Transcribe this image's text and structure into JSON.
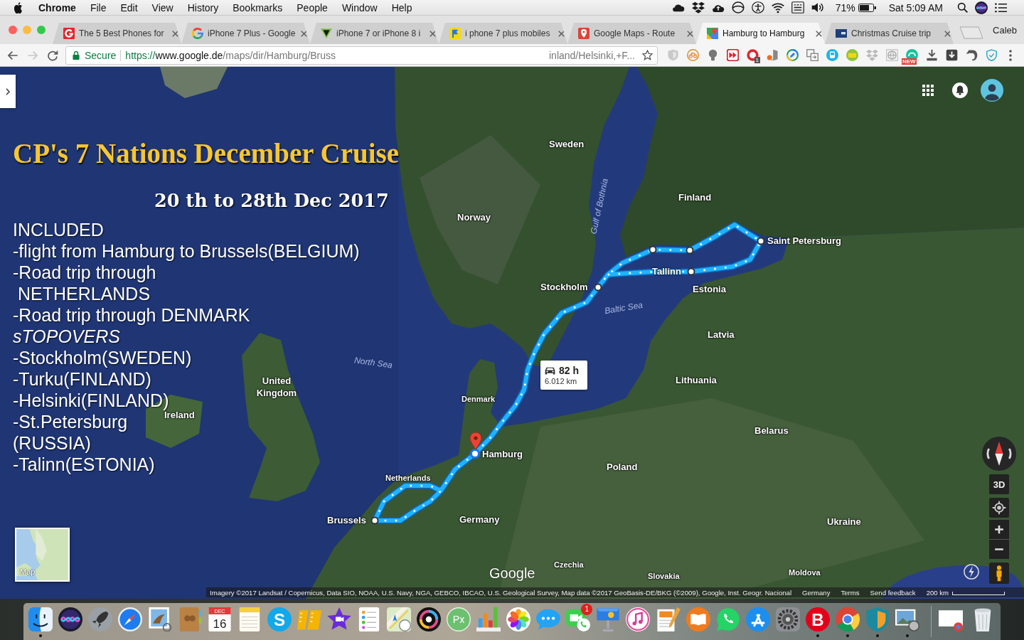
{
  "menu_bar": {
    "app_name": "Chrome",
    "items": [
      "File",
      "Edit",
      "View",
      "History",
      "Bookmarks",
      "People",
      "Window",
      "Help"
    ],
    "battery": "71%",
    "clock": "Sat 5:09 AM"
  },
  "tabs": [
    {
      "title": "The 5 Best Phones for",
      "selected": false
    },
    {
      "title": "iPhone 7 Plus - Google",
      "selected": false
    },
    {
      "title": "iPhone 7 or iPhone 8 i",
      "selected": false
    },
    {
      "title": "i phone 7 plus mobiles",
      "selected": false
    },
    {
      "title": "Google Maps - Route",
      "selected": false
    },
    {
      "title": "Hamburg to Hamburg",
      "selected": true
    },
    {
      "title": "Christmas Cruise trip",
      "selected": false
    }
  ],
  "profile": "Caleb",
  "toolbar": {
    "nav_buttons": [
      {
        "kind": "back",
        "disabled": false
      },
      {
        "kind": "forward",
        "disabled": true
      },
      {
        "kind": "reload",
        "disabled": false
      }
    ],
    "security": "Secure",
    "url": {
      "scheme": "https://",
      "host": "www.google.de",
      "path": "/maps/dir/Hamburg/Bruss",
      "tail": "inland/Helsinki,+F..."
    },
    "extensions": [
      {
        "kind": "shield"
      },
      {
        "kind": "bicycle"
      },
      {
        "kind": "bulb"
      },
      {
        "kind": "forward"
      },
      {
        "kind": "ring",
        "badge": "1"
      },
      {
        "kind": "office"
      },
      {
        "kind": "pen"
      },
      {
        "kind": "copy"
      },
      {
        "kind": "bus"
      },
      {
        "kind": "card"
      },
      {
        "kind": "boxes"
      },
      {
        "kind": "globe"
      },
      {
        "kind": "arc",
        "badge": "NEW"
      },
      {
        "kind": "tray"
      },
      {
        "kind": "download"
      },
      {
        "kind": "elephant"
      },
      {
        "kind": "check-shield"
      }
    ]
  },
  "map": {
    "title": "CP's 7 Nations December Cruise",
    "dates": "20 th to 28th Dec 2017",
    "included_lines": [
      {
        "text": "INCLUDED",
        "italic": false
      },
      {
        "text": "-flight from Hamburg to Brussels(BELGIUM)",
        "italic": false
      },
      {
        "text": "-Road trip through",
        "italic": false
      },
      {
        "text": " NETHERLANDS",
        "italic": false
      },
      {
        "text": "-Road trip through DENMARK",
        "italic": false
      },
      {
        "text": "sTOPOVERS",
        "italic": true
      },
      {
        "text": "-Stockholm(SWEDEN)",
        "italic": false
      },
      {
        "text": "-Turku(FINLAND)",
        "italic": false
      },
      {
        "text": "-Helsinki(FINLAND)",
        "italic": false
      },
      {
        "text": "-St.Petersburg",
        "italic": false
      },
      {
        "text": "(RUSSIA)",
        "italic": false
      },
      {
        "text": "-Talinn(ESTONIA)",
        "italic": false
      }
    ],
    "labels": [
      {
        "text": "Sweden",
        "kind": "country"
      },
      {
        "text": "Finland",
        "kind": "country"
      },
      {
        "text": "Gulf of Bothnia",
        "kind": "sea"
      },
      {
        "text": "Norway",
        "kind": "country"
      },
      {
        "text": "Saint Petersburg",
        "kind": "city"
      },
      {
        "text": "Tallinn",
        "kind": "city"
      },
      {
        "text": "Stockholm",
        "kind": "city"
      },
      {
        "text": "Estonia",
        "kind": "country"
      },
      {
        "text": "Baltic Sea",
        "kind": "sea"
      },
      {
        "text": "Latvia",
        "kind": "country"
      },
      {
        "text": "North Sea",
        "kind": "sea"
      },
      {
        "text": "Lithuania",
        "kind": "country"
      },
      {
        "text": "United Kingdom",
        "kind": "country"
      },
      {
        "text": "Denmark",
        "kind": "minor"
      },
      {
        "text": "Ireland",
        "kind": "country"
      },
      {
        "text": "Belarus",
        "kind": "country"
      },
      {
        "text": "Hamburg",
        "kind": "city"
      },
      {
        "text": "Poland",
        "kind": "country"
      },
      {
        "text": "Netherlands",
        "kind": "minor"
      },
      {
        "text": "Brussels",
        "kind": "city"
      },
      {
        "text": "Germany",
        "kind": "country"
      },
      {
        "text": "Ukraine",
        "kind": "country"
      },
      {
        "text": "Czechia",
        "kind": "minor"
      },
      {
        "text": "Moldova",
        "kind": "minor"
      },
      {
        "text": "Slovakia",
        "kind": "minor"
      }
    ],
    "route_summary": {
      "duration": "82 h",
      "distance": "6.012 km"
    },
    "layer_button": "Map",
    "logo": "Google",
    "tilt_button": "3D",
    "attribution": {
      "imagery": "Imagery ©2017 Landsat / Copernicus, Data SIO, NOAA, U.S. Navy, NGA, GEBCO, IBCAO, U.S. Geological Survey, Map data ©2017 GeoBasis-DE/BKG (©2009), Google, Inst. Geogr. Nacional",
      "region": "Germany",
      "links": [
        "Terms",
        "Send feedback"
      ],
      "scale": "200 km"
    }
  },
  "dock": {
    "apps": [
      {
        "kind": "face",
        "running": true
      },
      {
        "kind": "orb",
        "running": false
      },
      {
        "kind": "rocket",
        "running": false
      },
      {
        "kind": "compass",
        "running": false
      },
      {
        "kind": "stamp",
        "running": false
      },
      {
        "kind": "book",
        "running": false
      },
      {
        "kind": "calendar",
        "running": false,
        "month": "DEC",
        "day": "16"
      },
      {
        "kind": "notepad",
        "running": false
      },
      {
        "kind": "chat-letter",
        "running": false,
        "text": "S"
      },
      {
        "kind": "strips",
        "running": false
      },
      {
        "kind": "star",
        "running": false
      },
      {
        "kind": "checklist",
        "running": false
      },
      {
        "kind": "map",
        "running": false
      },
      {
        "kind": "lens",
        "running": false
      },
      {
        "kind": "editor-letter",
        "running": false,
        "text": "Px"
      },
      {
        "kind": "bars",
        "running": false
      },
      {
        "kind": "flower",
        "running": false
      },
      {
        "kind": "bubble",
        "running": false
      },
      {
        "kind": "video",
        "running": false,
        "badge": "1"
      },
      {
        "kind": "podium",
        "running": false
      },
      {
        "kind": "note",
        "running": false
      },
      {
        "kind": "pages",
        "running": false
      },
      {
        "kind": "openbook",
        "running": false
      },
      {
        "kind": "phone-bubble",
        "running": false
      },
      {
        "kind": "strokes",
        "running": false
      },
      {
        "kind": "gear",
        "running": false
      },
      {
        "kind": "security-letter",
        "running": true,
        "text": "B"
      },
      {
        "kind": "ring3",
        "running": true
      },
      {
        "kind": "shield",
        "running": true
      },
      {
        "kind": "photos",
        "running": true
      }
    ],
    "trailing": [
      {
        "kind": "window"
      },
      {
        "kind": "trash"
      }
    ]
  }
}
